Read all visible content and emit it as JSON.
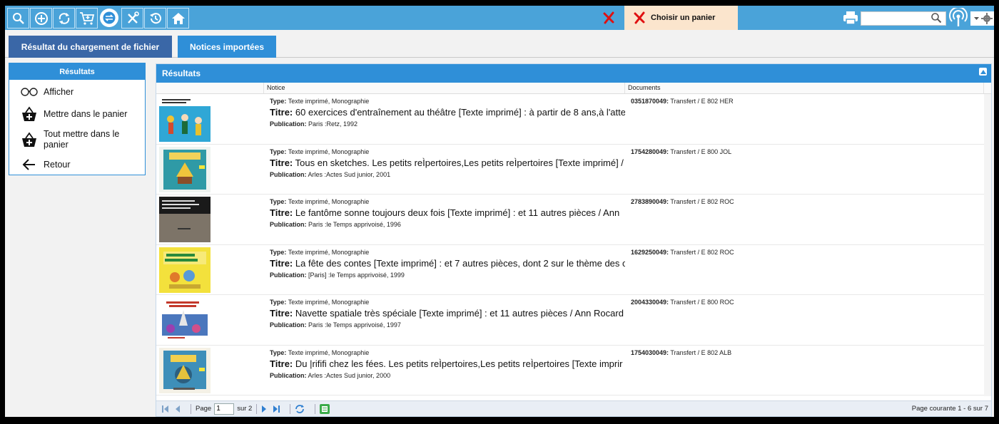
{
  "toolbar": {
    "icons": [
      "search-icon",
      "add-circle-icon",
      "refresh-icon",
      "cart-icon",
      "transfer-icon",
      "tools-icon",
      "history-icon",
      "home-icon"
    ],
    "basket_label": "Choisir un panier",
    "search": {
      "value": "",
      "placeholder": ""
    }
  },
  "tabs": [
    {
      "label": "Résultat du chargement de fichier"
    },
    {
      "label": "Notices importées"
    }
  ],
  "left_panel": {
    "title": "Résultats",
    "items": [
      {
        "label": "Afficher",
        "icon": "glasses-icon"
      },
      {
        "label": "Mettre dans le panier",
        "icon": "basket-add-icon"
      },
      {
        "label": "Tout mettre dans le panier",
        "icon": "basket-add-icon"
      },
      {
        "label": "Retour",
        "icon": "arrow-left-icon"
      }
    ]
  },
  "results": {
    "title": "Résultats",
    "columns": {
      "notice": "Notice",
      "documents": "Documents"
    },
    "type_label": "Type:",
    "title_label": "Titre:",
    "publication_label": "Publication:",
    "rows": [
      {
        "type": "Texte imprimé, Monographie",
        "titre": "60 exercices d'entraînement au théâtre [Texte imprimé] : à partir de 8 ans,à l'atte",
        "publication": "Paris :Retz, 1992",
        "doc_id": "0351870049:",
        "doc_info": "Transfert / E 802 HER"
      },
      {
        "type": "Texte imprimé, Monographie",
        "titre": "Tous en sketches. Les petits reÌpertoires,Les petits reÌpertoires [Texte imprimé] /",
        "publication": "Arles :Actes Sud junior, 2001",
        "doc_id": "1754280049:",
        "doc_info": "Transfert / E 800 JOL"
      },
      {
        "type": "Texte imprimé, Monographie",
        "titre": "Le fantôme sonne toujours deux fois [Texte imprimé] : et 11 autres pièces / Ann",
        "publication": "Paris :le Temps apprivoisé, 1996",
        "doc_id": "2783890049:",
        "doc_info": "Transfert / E 802 ROC"
      },
      {
        "type": "Texte imprimé, Monographie",
        "titre": "La fête des contes [Texte imprimé] : et 7 autres pièces, dont 2 sur le thème des c",
        "publication": "[Paris] :le Temps apprivoisé, 1999",
        "doc_id": "1629250049:",
        "doc_info": "Transfert / E 802 ROC"
      },
      {
        "type": "Texte imprimé, Monographie",
        "titre": "Navette spatiale très spéciale [Texte imprimé] : et 11 autres pièces / Ann Rocard",
        "publication": "Paris :le Temps apprivoisé, 1997",
        "doc_id": "2004330049:",
        "doc_info": "Transfert / E 800 ROC"
      },
      {
        "type": "Texte imprimé, Monographie",
        "titre": "Du |rififi chez les fées. Les petits reÌpertoires,Les petits reÌpertoires [Texte imprir",
        "publication": "Arles :Actes Sud junior, 2000",
        "doc_id": "1754030049:",
        "doc_info": "Transfert / E 802 ALB"
      }
    ]
  },
  "pager": {
    "page_label": "Page",
    "page_value": "1",
    "of_label": "sur 2",
    "info": "Page courante 1 - 6 sur 7"
  },
  "colors": {
    "toolbar": "#4aa3d9",
    "tab_primary": "#3a67a7",
    "accent": "#2f8fd8",
    "basket_bg": "#fbe5cd",
    "cancel_red": "#e01010"
  }
}
